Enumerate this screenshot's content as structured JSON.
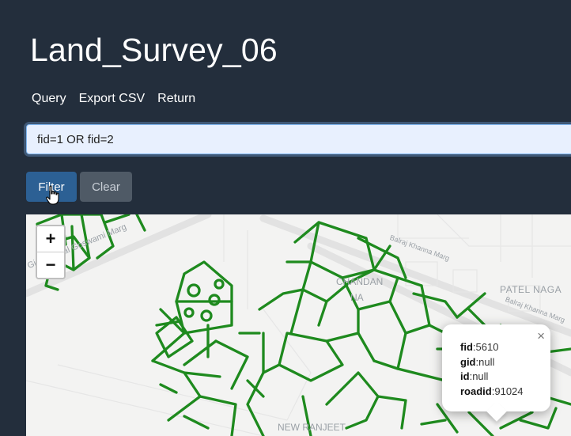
{
  "header": {
    "title": "Land_Survey_06"
  },
  "nav": {
    "items": [
      {
        "label": "Query"
      },
      {
        "label": "Export CSV"
      },
      {
        "label": "Return"
      }
    ]
  },
  "query": {
    "value": "fid=1 OR fid=2"
  },
  "buttons": {
    "filter_label": "Filter",
    "clear_label": "Clear"
  },
  "map": {
    "zoom_in": "+",
    "zoom_out": "−",
    "labels": {
      "road_goswami": "Girdhari Lal Goswami Marg",
      "road_khanna_1": "Balraj Khanna Marg",
      "road_khanna_2": "Balraj Khanna Marg",
      "area_patel": "PATEL NAGA",
      "area_chandan": "CHANDAN",
      "area_na": "NA",
      "area_ranjeet": "NEW RANJEET"
    },
    "feature_color": "#1e8a1e",
    "popup": {
      "close": "×",
      "fields": [
        {
          "key": "fid",
          "value": "5610"
        },
        {
          "key": "gid",
          "value": "null"
        },
        {
          "key": "id",
          "value": "null"
        },
        {
          "key": "roadid",
          "value": "91024"
        }
      ]
    }
  }
}
